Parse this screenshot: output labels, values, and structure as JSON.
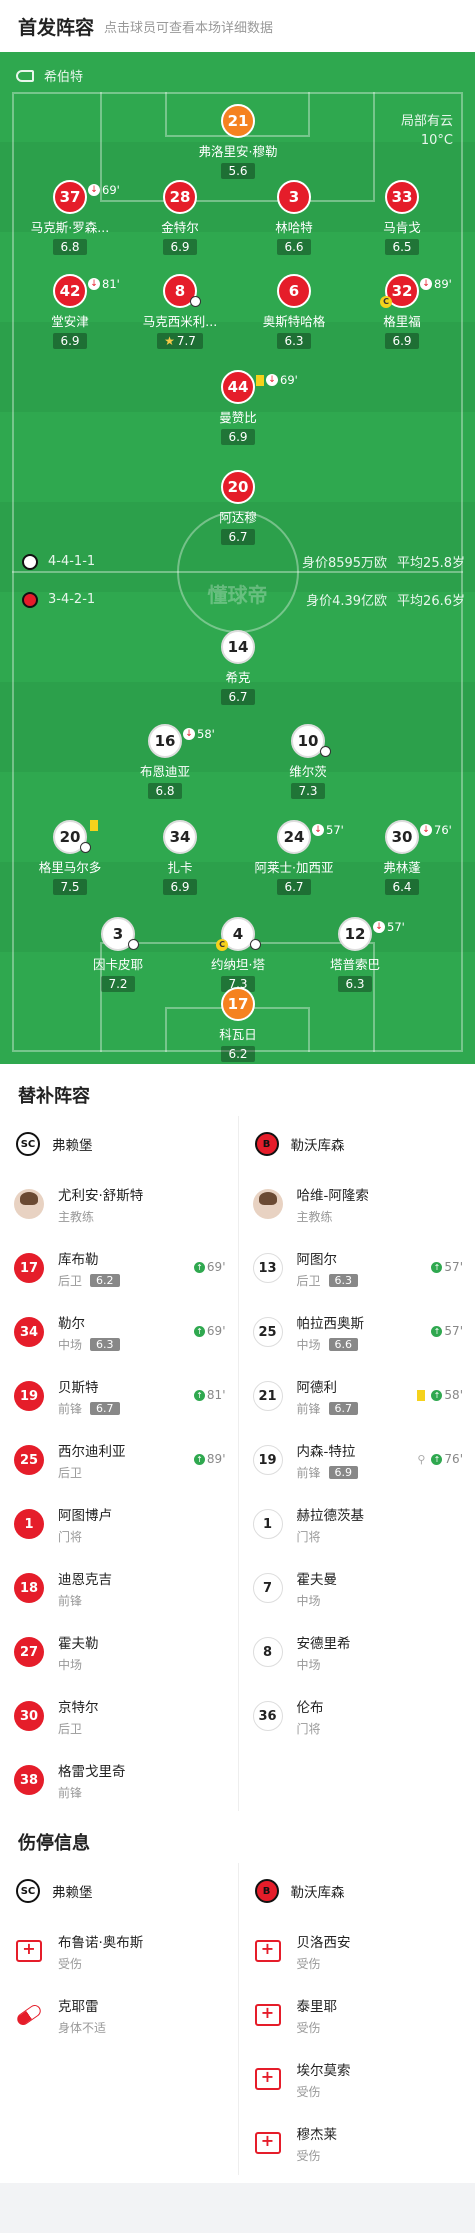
{
  "header": {
    "title": "首发阵容",
    "subtitle": "点击球员可查看本场详细数据"
  },
  "pitch": {
    "referee": "希伯特",
    "weather": "局部有云",
    "temperature": "10°C",
    "watermark": "懂球帝",
    "home": {
      "formation": "4-4-1-1",
      "value": "身价8595万欧",
      "age": "平均25.8岁"
    },
    "away": {
      "formation": "3-4-2-1",
      "value": "身价4.39亿欧",
      "age": "平均26.6岁"
    },
    "home_players": [
      {
        "num": "21",
        "name": "弗洛里安·穆勒",
        "rating": "5.6"
      },
      {
        "num": "37",
        "name": "马克斯·罗森...",
        "rating": "6.8",
        "event": "69'"
      },
      {
        "num": "28",
        "name": "金特尔",
        "rating": "6.9"
      },
      {
        "num": "3",
        "name": "林哈特",
        "rating": "6.6"
      },
      {
        "num": "33",
        "name": "马肯戈",
        "rating": "6.5"
      },
      {
        "num": "42",
        "name": "堂安津",
        "rating": "6.9",
        "event": "81'"
      },
      {
        "num": "8",
        "name": "马克西米利...",
        "rating": "7.7"
      },
      {
        "num": "6",
        "name": "奥斯特哈格",
        "rating": "6.3"
      },
      {
        "num": "32",
        "name": "格里福",
        "rating": "6.9",
        "event": "89'"
      },
      {
        "num": "44",
        "name": "曼赞比",
        "rating": "6.9",
        "event": "69'"
      },
      {
        "num": "20",
        "name": "阿达穆",
        "rating": "6.7"
      }
    ],
    "away_players": [
      {
        "num": "14",
        "name": "希克",
        "rating": "6.7"
      },
      {
        "num": "16",
        "name": "布恩迪亚",
        "rating": "6.8",
        "event": "58'"
      },
      {
        "num": "10",
        "name": "维尔茨",
        "rating": "7.3"
      },
      {
        "num": "20",
        "name": "格里马尔多",
        "rating": "7.5"
      },
      {
        "num": "34",
        "name": "扎卡",
        "rating": "6.9"
      },
      {
        "num": "24",
        "name": "阿莱士·加西亚",
        "rating": "6.7",
        "event": "57'"
      },
      {
        "num": "30",
        "name": "弗林蓬",
        "rating": "6.4",
        "event": "76'"
      },
      {
        "num": "3",
        "name": "因卡皮耶",
        "rating": "7.2"
      },
      {
        "num": "4",
        "name": "约纳坦·塔",
        "rating": "7.3"
      },
      {
        "num": "12",
        "name": "塔普索巴",
        "rating": "6.3",
        "event": "57'"
      },
      {
        "num": "17",
        "name": "科瓦日",
        "rating": "6.2"
      }
    ]
  },
  "subs": {
    "title": "替补阵容",
    "home_team": "弗赖堡",
    "away_team": "勒沃库森",
    "home_coach": {
      "name": "尤利安·舒斯特",
      "role": "主教练"
    },
    "away_coach": {
      "name": "哈维-阿隆索",
      "role": "主教练"
    },
    "home": [
      {
        "num": "17",
        "name": "库布勒",
        "pos": "后卫",
        "rating": "6.2",
        "time": "69'",
        "played": true
      },
      {
        "num": "34",
        "name": "勒尔",
        "pos": "中场",
        "rating": "6.3",
        "time": "69'",
        "played": true
      },
      {
        "num": "19",
        "name": "贝斯特",
        "pos": "前锋",
        "rating": "6.7",
        "time": "81'",
        "played": true
      },
      {
        "num": "25",
        "name": "西尔迪利亚",
        "pos": "后卫",
        "rating": "",
        "time": "89'",
        "played": true
      },
      {
        "num": "1",
        "name": "阿图博卢",
        "pos": "门将",
        "played": false
      },
      {
        "num": "18",
        "name": "迪恩克吉",
        "pos": "前锋",
        "played": false
      },
      {
        "num": "27",
        "name": "霍夫勒",
        "pos": "中场",
        "played": false
      },
      {
        "num": "30",
        "name": "京特尔",
        "pos": "后卫",
        "played": false
      },
      {
        "num": "38",
        "name": "格雷戈里奇",
        "pos": "前锋",
        "played": false
      }
    ],
    "away": [
      {
        "num": "13",
        "name": "阿图尔",
        "pos": "后卫",
        "rating": "6.3",
        "time": "57'",
        "played": true
      },
      {
        "num": "25",
        "name": "帕拉西奥斯",
        "pos": "中场",
        "rating": "6.6",
        "time": "57'",
        "played": true
      },
      {
        "num": "21",
        "name": "阿德利",
        "pos": "前锋",
        "rating": "6.7",
        "time": "58'",
        "played": true,
        "card": true
      },
      {
        "num": "19",
        "name": "内森-特拉",
        "pos": "前锋",
        "rating": "6.9",
        "time": "76'",
        "played": true,
        "kick": true
      },
      {
        "num": "1",
        "name": "赫拉德茨基",
        "pos": "门将",
        "played": false
      },
      {
        "num": "7",
        "name": "霍夫曼",
        "pos": "中场",
        "played": false
      },
      {
        "num": "8",
        "name": "安德里希",
        "pos": "中场",
        "played": false
      },
      {
        "num": "36",
        "name": "伦布",
        "pos": "门将",
        "played": false
      }
    ]
  },
  "injury": {
    "title": "伤停信息",
    "home_team": "弗赖堡",
    "away_team": "勒沃库森",
    "home": [
      {
        "name": "布鲁诺·奥布斯",
        "status": "受伤",
        "type": "injury"
      },
      {
        "name": "克耶雷",
        "status": "身体不适",
        "type": "ill"
      }
    ],
    "away": [
      {
        "name": "贝洛西安",
        "status": "受伤",
        "type": "injury"
      },
      {
        "name": "泰里耶",
        "status": "受伤",
        "type": "injury"
      },
      {
        "name": "埃尔莫索",
        "status": "受伤",
        "type": "injury"
      },
      {
        "name": "穆杰莱",
        "status": "受伤",
        "type": "injury"
      }
    ]
  }
}
